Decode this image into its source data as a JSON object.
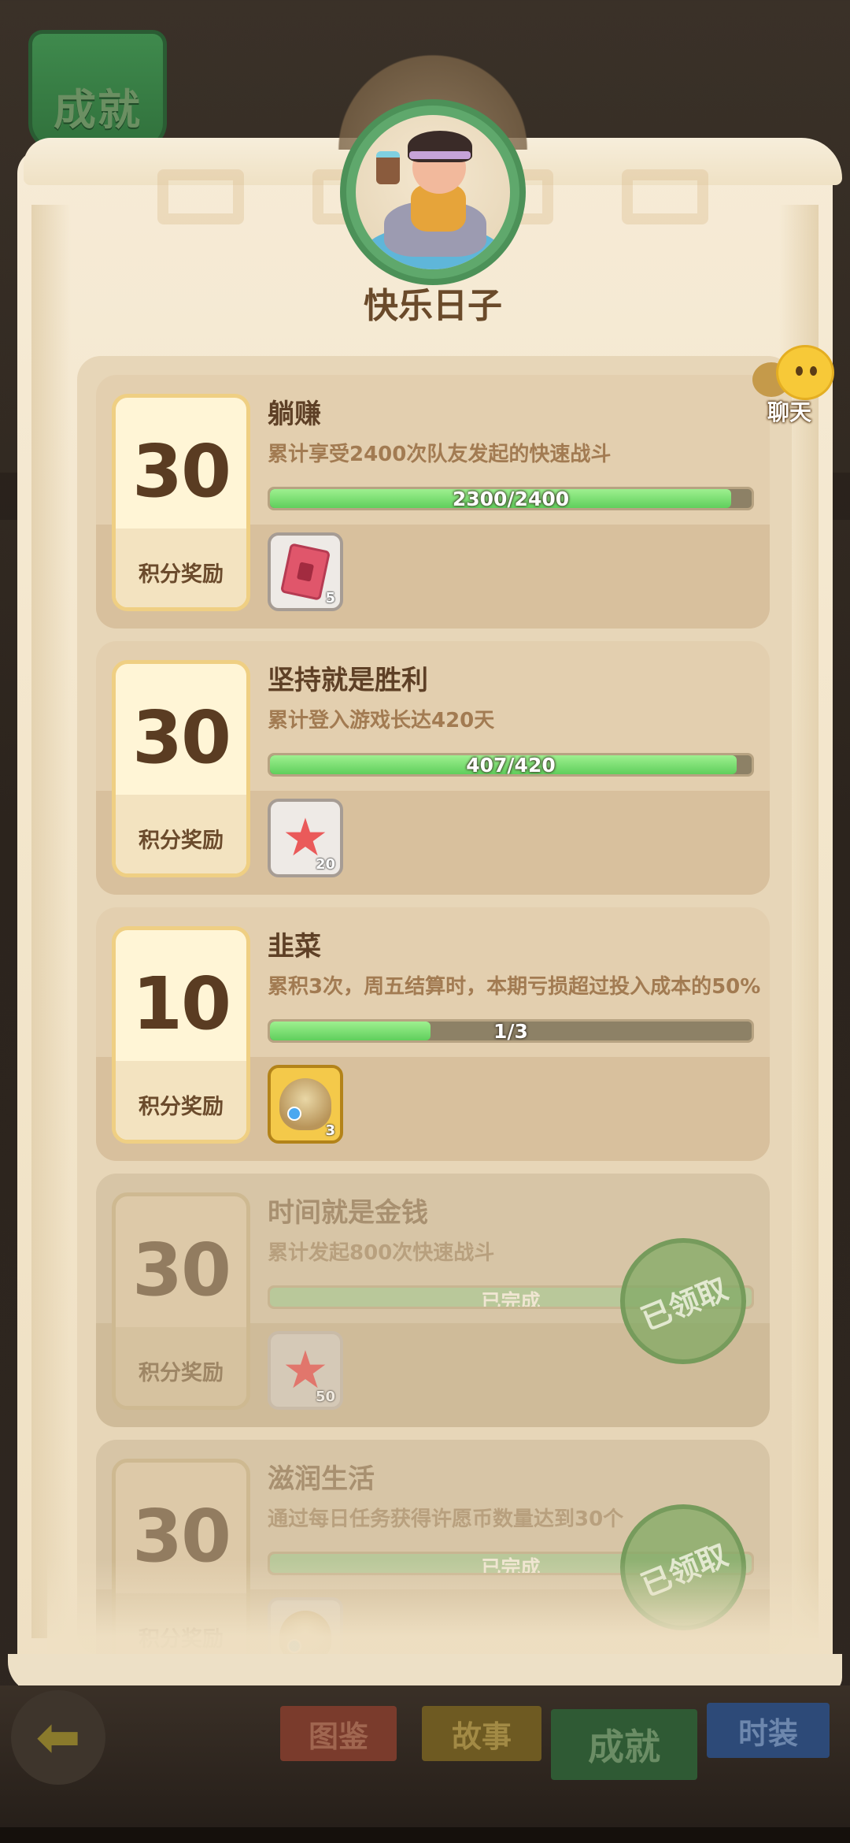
{
  "corner_tab": "成就",
  "header": {
    "title": "快乐日子"
  },
  "chat": {
    "label": "聊天"
  },
  "achievements": [
    {
      "points": "30",
      "reward_label": "积分奖励",
      "title": "躺赚",
      "desc": "累计享受2400次队友发起的快速战斗",
      "progress_text": "2300/2400",
      "progress": 0.958,
      "item": {
        "icon": "ticket-icon",
        "qty": "5"
      },
      "completed": false
    },
    {
      "points": "30",
      "reward_label": "积分奖励",
      "title": "坚持就是胜利",
      "desc": "累计登入游戏长达420天",
      "progress_text": "407/420",
      "progress": 0.969,
      "item": {
        "icon": "starfish-icon",
        "qty": "20"
      },
      "completed": false
    },
    {
      "points": "10",
      "reward_label": "积分奖励",
      "title": "韭菜",
      "desc": "累积3次，周五结算时，本期亏损超过投入成本的50%",
      "progress_text": "1/3",
      "progress": 0.333,
      "item": {
        "icon": "pouch-icon",
        "qty": "3"
      },
      "completed": false
    },
    {
      "points": "30",
      "reward_label": "积分奖励",
      "title": "时间就是金钱",
      "desc": "累计发起800次快速战斗",
      "progress_text": "已完成",
      "progress": 1.0,
      "item": {
        "icon": "starfish-icon",
        "qty": "50"
      },
      "completed": true,
      "stamp": "已领取"
    },
    {
      "points": "30",
      "reward_label": "积分奖励",
      "title": "滋润生活",
      "desc": "通过每日任务获得许愿币数量达到30个",
      "progress_text": "已完成",
      "progress": 1.0,
      "item": {
        "icon": "pouch-icon",
        "qty": ""
      },
      "completed": true,
      "stamp": "已领取"
    }
  ],
  "nav": {
    "tab1": "图鉴",
    "tab2": "故事",
    "tab3": "成就",
    "tab4": "时装"
  },
  "colors": {
    "progress_green": "#5fcf5c",
    "accent_brown": "#5a3c22",
    "stamp_green": "#82aa64"
  }
}
